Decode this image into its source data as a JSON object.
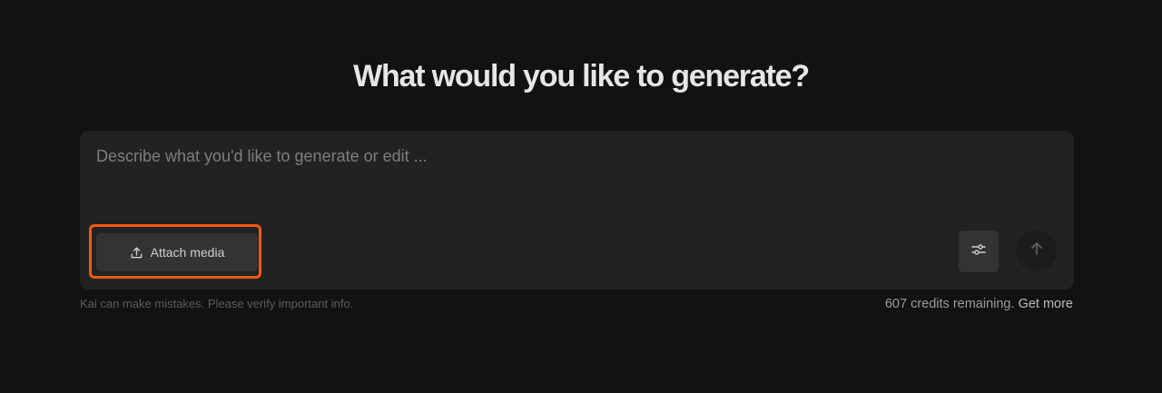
{
  "heading": "What would you like to generate?",
  "composer": {
    "prompt_placeholder": "Describe what you'd like to generate or edit ...",
    "prompt_value": "",
    "attach_label": "Attach media",
    "attach_icon": "upload-icon",
    "settings_icon": "sliders-icon",
    "send_icon": "arrow-up-icon"
  },
  "footer": {
    "disclaimer": "Kai can make mistakes. Please verify important info.",
    "credits_text": "607 credits remaining.",
    "get_more_label": "Get more"
  },
  "colors": {
    "background": "#121212",
    "panel": "#222222",
    "button": "#333333",
    "highlight": "#f25a0f"
  }
}
